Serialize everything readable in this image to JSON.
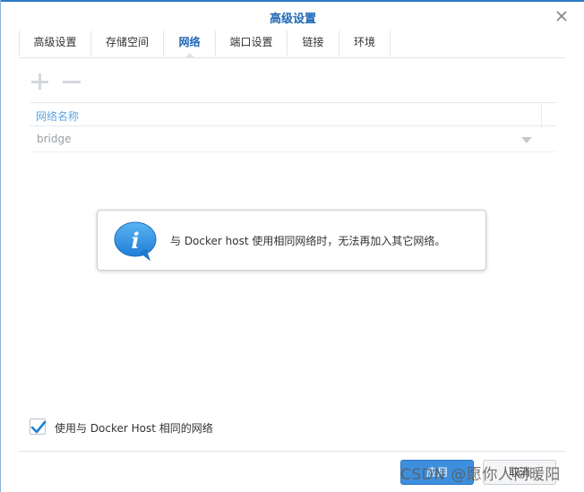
{
  "window": {
    "title": "高级设置"
  },
  "tabs": [
    {
      "label": "高级设置",
      "active": false
    },
    {
      "label": "存储空间",
      "active": false
    },
    {
      "label": "网络",
      "active": true
    },
    {
      "label": "端口设置",
      "active": false
    },
    {
      "label": "链接",
      "active": false
    },
    {
      "label": "环境",
      "active": false
    }
  ],
  "toolbar": {
    "add_icon": "plus-icon",
    "remove_icon": "minus-icon"
  },
  "grid": {
    "column_header": "网络名称",
    "rows": [
      {
        "value": "bridge"
      }
    ]
  },
  "info": {
    "icon": "info-bubble-icon",
    "message": "与 Docker host 使用相同网络时，无法再加入其它网络。"
  },
  "option": {
    "checked": true,
    "label": "使用与 Docker Host 相同的网络"
  },
  "buttons": {
    "apply": "应用",
    "cancel": "取消"
  },
  "watermark": "CSDN @愿你人间暖阳",
  "colors": {
    "accent": "#1d67b6",
    "primary_button": "#3d8fde",
    "info_blue": "#2f8fe0"
  }
}
